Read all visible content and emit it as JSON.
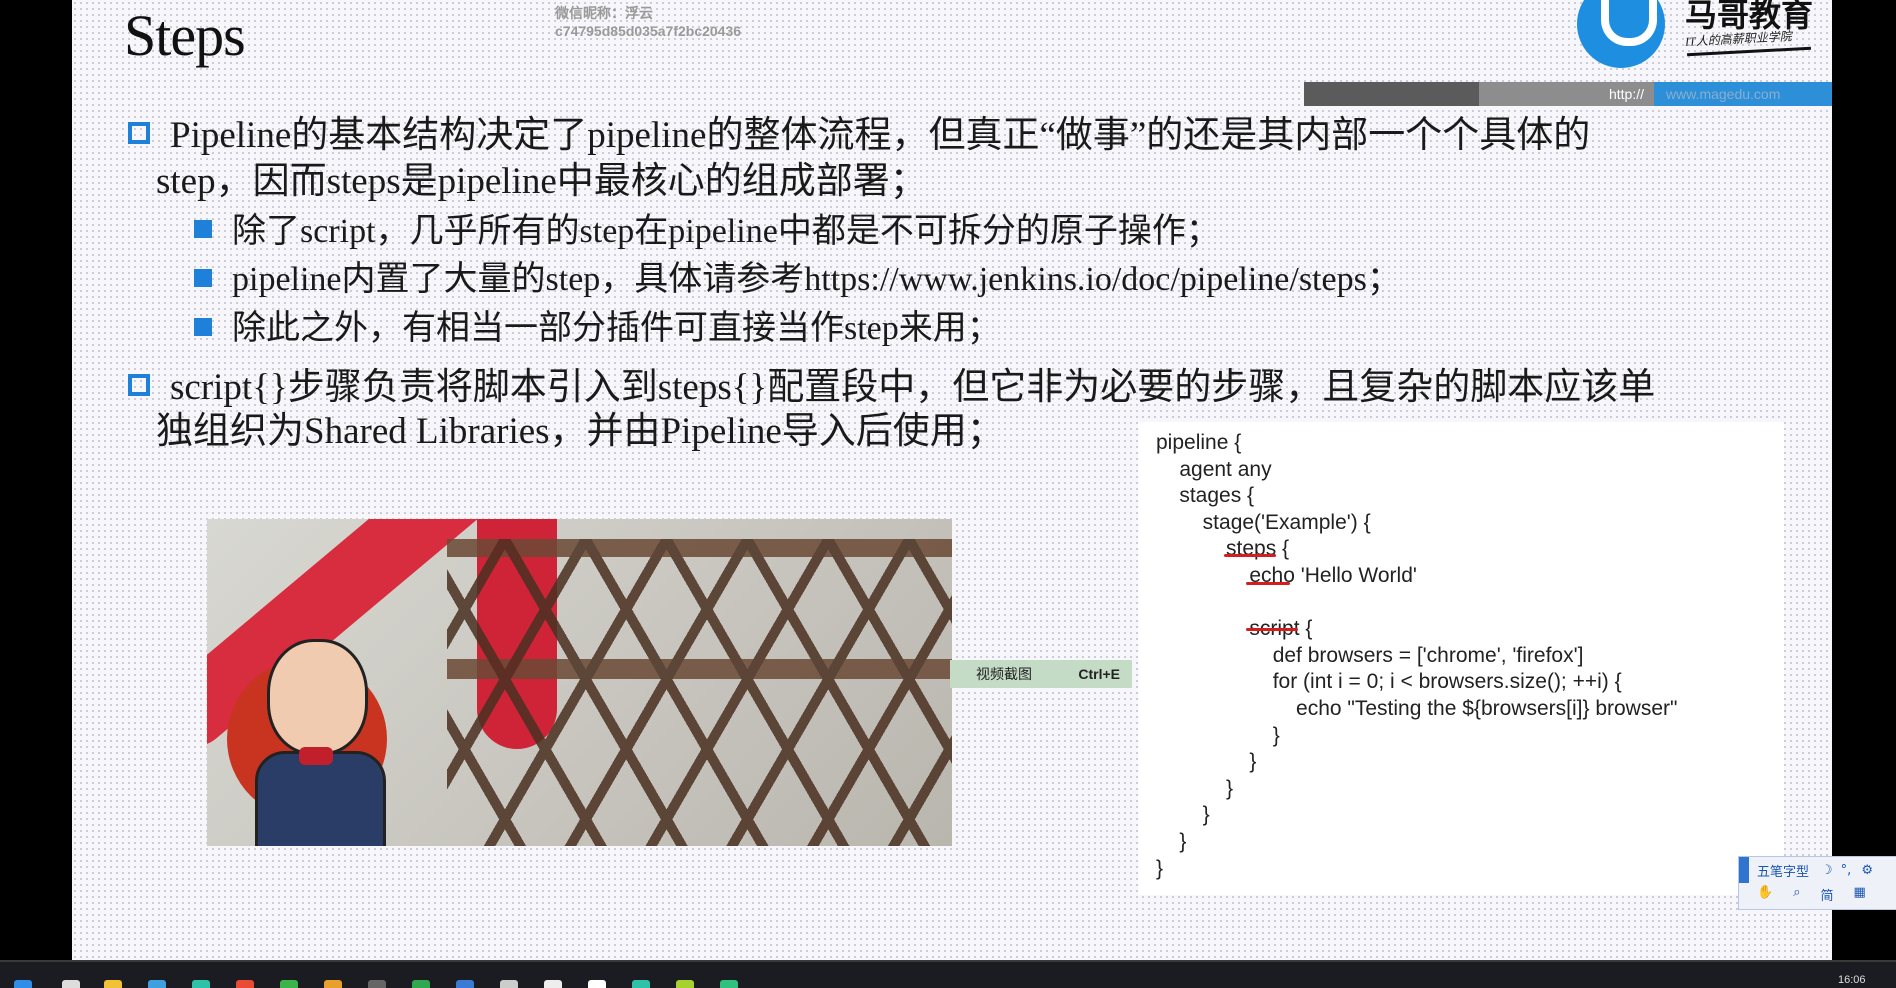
{
  "slide": {
    "title": "Steps",
    "watermark": {
      "line1": "微信昵称：浮云",
      "line2": "c74795d85d035a7f2bc20436"
    },
    "logo": {
      "name": "马哥教育",
      "subtitle": "IT人的高薪职业学院"
    },
    "url_bar": {
      "prefix": "http://",
      "url": "www.magedu.com"
    },
    "bullets": [
      {
        "line1": "Pipeline的基本结构决定了pipeline的整体流程，但真正“做事”的还是其内部一个个具体的",
        "line2": "step，因而steps是pipeline中最核心的组成部署；"
      },
      {
        "line1": "script{}步骤负责将脚本引入到steps{}配置段中，但它非为必要的步骤，且复杂的脚本应该单",
        "line2": "独组织为Shared Libraries，并由Pipeline导入后使用；"
      }
    ],
    "sub_bullets": [
      "除了script，几乎所有的step在pipeline中都是不可拆分的原子操作；",
      "pipeline内置了大量的step，具体请参考https://www.jenkins.io/doc/pipeline/steps；",
      "除此之外，有相当一部分插件可直接当作step来用；"
    ],
    "code_lines": [
      "pipeline {",
      "    agent any",
      "    stages {",
      "        stage('Example') {",
      "            steps {",
      "                echo 'Hello World'",
      "",
      "                script {",
      "                    def browsers = ['chrome', 'firefox']",
      "                    for (int i = 0; i < browsers.size(); ++i) {",
      "                        echo \"Testing the ${browsers[i]} browser\"",
      "                    }",
      "                }",
      "            }",
      "        }",
      "    }",
      "}"
    ]
  },
  "tooltip": {
    "label": "视频截图",
    "shortcut": "Ctrl+E"
  },
  "ime": {
    "mode": "五笔字型",
    "simplified": "简"
  },
  "clock": "16:06",
  "colors": {
    "accent": "#1e80d8",
    "underline": "#d61d1d"
  }
}
